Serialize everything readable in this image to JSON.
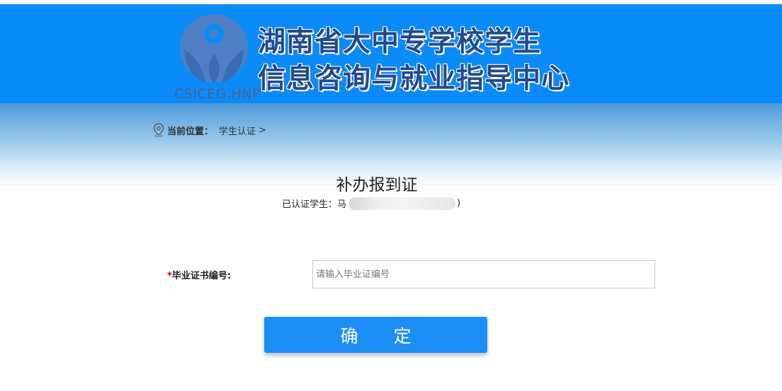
{
  "header": {
    "logo_text": "CSICEG.HNP",
    "org_name_line1": "湖南省大中专学校学生",
    "org_name_line2": "信息咨询与就业指导中心"
  },
  "breadcrumb": {
    "label": "当前位置：",
    "current": "学生认证",
    "separator": ">"
  },
  "main": {
    "title": "补办报到证",
    "student_label": "已认证学生：",
    "student_value_fragment": "马",
    "student_close_paren": ")"
  },
  "form": {
    "required_mark": "*",
    "cert_label": "毕业证书编号:",
    "cert_placeholder": "请输入毕业证编号",
    "cert_value": ""
  },
  "actions": {
    "confirm_label": "确定"
  },
  "colors": {
    "banner": "#0b8bf8",
    "button": "#1d8ef5",
    "required": "#d40000"
  }
}
